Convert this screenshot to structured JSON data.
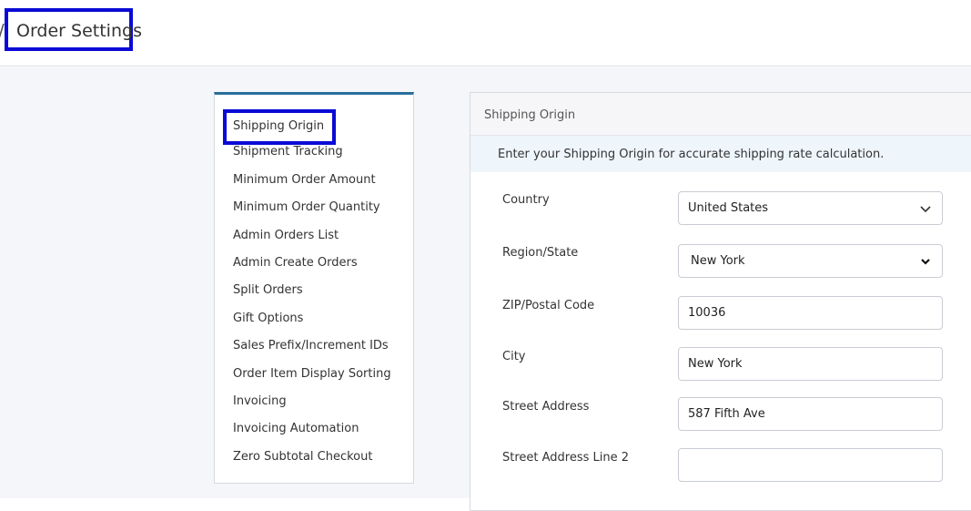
{
  "header": {
    "separator": "/",
    "title": "Order Settings"
  },
  "sidebar": {
    "items": [
      {
        "label": "Shipping Origin",
        "active": true
      },
      {
        "label": "Shipment Tracking"
      },
      {
        "label": "Minimum Order Amount"
      },
      {
        "label": "Minimum Order Quantity"
      },
      {
        "label": "Admin Orders List"
      },
      {
        "label": "Admin Create Orders"
      },
      {
        "label": "Split Orders"
      },
      {
        "label": "Gift Options"
      },
      {
        "label": "Sales Prefix/Increment IDs"
      },
      {
        "label": "Order Item Display Sorting"
      },
      {
        "label": "Invoicing"
      },
      {
        "label": "Invoicing Automation"
      },
      {
        "label": "Zero Subtotal Checkout"
      }
    ]
  },
  "panel": {
    "title": "Shipping Origin",
    "info": "Enter your Shipping Origin for accurate shipping rate calculation.",
    "fields": {
      "country": {
        "label": "Country",
        "value": "United States"
      },
      "region": {
        "label": "Region/State",
        "value": "New York"
      },
      "zip": {
        "label": "ZIP/Postal Code",
        "value": "10036"
      },
      "city": {
        "label": "City",
        "value": "New York"
      },
      "street": {
        "label": "Street Address",
        "value": "587 Fifth Ave"
      },
      "street2": {
        "label": "Street Address Line 2",
        "value": ""
      }
    }
  },
  "colors": {
    "highlight": "#0a0ad6",
    "sidebar_accent": "#2b6f9c",
    "info_background": "#eef5fb"
  }
}
